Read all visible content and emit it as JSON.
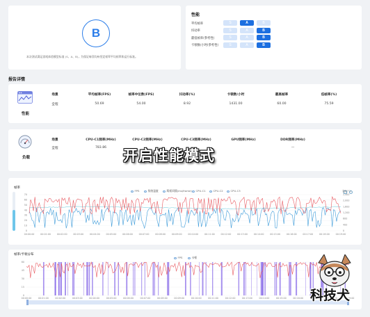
{
  "summary": {
    "grade": "B",
    "note": "本次测试满足游戏体验模型标准 (S、A、B)，为保证每项均有恒定帧率平均帧率和运行标准。"
  },
  "performance": {
    "title": "性能",
    "rows": [
      {
        "label": "平均帧率",
        "opts": [
          "S",
          "A",
          "B"
        ],
        "selected": 1
      },
      {
        "label": "抖动率",
        "opts": [
          "S",
          "A",
          "B"
        ],
        "selected": 2
      },
      {
        "label": "最低帧率(参考性)",
        "opts": [
          "S",
          "A",
          "B"
        ],
        "selected": 2
      },
      {
        "label": "卡顿数/小时(参考性)",
        "opts": [
          "S",
          "A",
          "B"
        ],
        "selected": 2
      }
    ]
  },
  "report": {
    "title": "报告详情",
    "perf_block": {
      "label": "性能",
      "headers": [
        "场景",
        "平均帧率(FPS)",
        "帧率中位数(FPS)",
        "抖动率(%)",
        "卡顿数/小时",
        "最高帧率",
        "低帧率(%)"
      ],
      "values": [
        "全程",
        "50.69",
        "54.00",
        "8.92",
        "1431.00",
        "60.00",
        "75.59"
      ]
    },
    "load_block": {
      "label": "负载",
      "headers": [
        "场景",
        "CPU-C1频率(MHz)",
        "CPU-C2频率(MHz)",
        "CPU-C3频率(MHz)",
        "GPU频率(MHz)",
        "DDR频率(MHz)"
      ],
      "values": [
        "全程",
        "783.86",
        "",
        "",
        "",
        "—"
      ]
    }
  },
  "overlay_caption": "开启性能模式",
  "chart1": {
    "title": "帧率",
    "legend": [
      "FPS",
      "系统温度",
      "两帧间隔(ms/frame)",
      "CPU-C1",
      "CPU-C2",
      "CPU-C3"
    ],
    "left_ticks": [
      "70",
      "60",
      "50",
      "40",
      "30",
      "20",
      "10",
      "0"
    ],
    "right_title": "温度(°C)",
    "right_ticks": [
      "2,400",
      "2,000",
      "1,600",
      "1,200",
      "800",
      "400",
      "0"
    ],
    "x_ticks": [
      "00:00:00",
      "00:01:00",
      "00:02:00",
      "00:03:00",
      "00:04:00",
      "00:05:00",
      "00:06:00",
      "00:07:00",
      "00:08:00",
      "00:09:00",
      "00:10:00",
      "00:11:00",
      "00:12:00",
      "00:13:00",
      "00:14:00",
      "00:15:00",
      "00:16:00",
      "00:17:00",
      "00:18:00",
      "00:19:00"
    ]
  },
  "chart2": {
    "title": "帧率/卡顿分布",
    "legend": [
      "FPS",
      "卡顿"
    ],
    "left_ticks": [
      "60",
      "45",
      "30",
      "15",
      "0"
    ],
    "x_ticks": [
      "00:00:00",
      "00:01:00",
      "00:02:00",
      "00:03:00",
      "00:04:00",
      "00:05:00",
      "00:06:00",
      "00:07:00",
      "00:08:00",
      "00:09:00",
      "00:10:00",
      "00:11:00",
      "00:12:00",
      "00:13:00",
      "00:14:00",
      "00:15:00",
      "00:16:00",
      "00:17:00",
      "00:18:00",
      "00:19:00"
    ]
  },
  "logo": {
    "text": "科技犬"
  },
  "colors": {
    "accent": "#1c6fe0",
    "fps_red": "#e8585f",
    "stutter": "#8a6de9",
    "cpu_blue": "#3d9bd9",
    "teal": "#7fd0e0"
  }
}
